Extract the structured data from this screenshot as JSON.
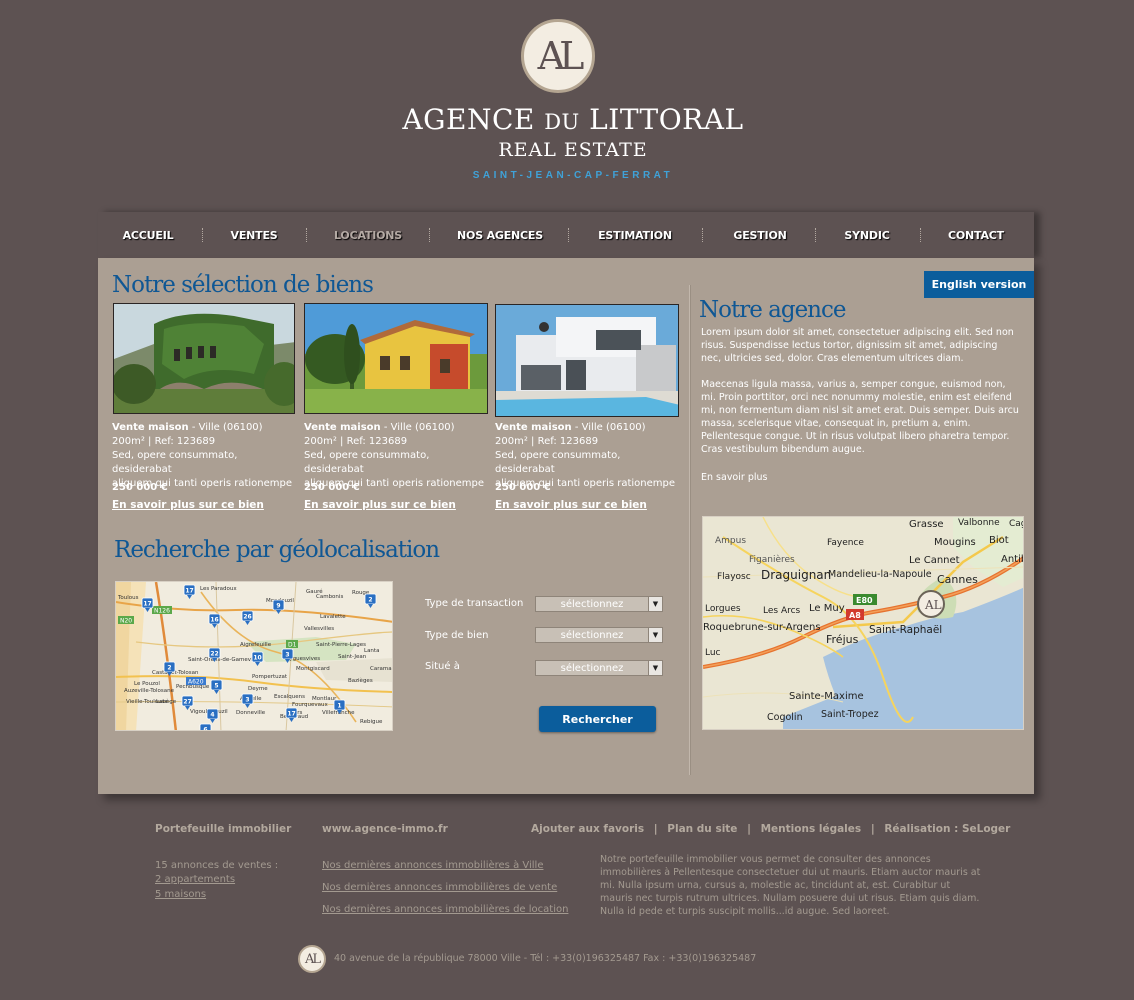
{
  "header": {
    "logo_monogram": "AL",
    "brand_agence": "AGENCE",
    "brand_du": "DU",
    "brand_littoral": "LITTORAL",
    "brand_subtitle": "REAL ESTATE",
    "brand_location": "SAINT-JEAN-CAP-FERRAT"
  },
  "nav": {
    "items": [
      "ACCUEIL",
      "VENTES",
      "LOCATIONS",
      "NOS AGENCES",
      "ESTIMATION",
      "GESTION",
      "SYNDIC",
      "CONTACT"
    ],
    "active": "LOCATIONS"
  },
  "english_button": "English version",
  "selection": {
    "title": "Notre sélection de biens",
    "cards": [
      {
        "type": "Vente maison",
        "city": "- Ville (06100)",
        "meta": "200m² | Ref: 123689",
        "desc1": "Sed, opere consummato, desiderabat",
        "desc2": "aliquem qui tanti operis rationempe",
        "price": "250 000 €",
        "link": "En savoir plus sur ce bien"
      },
      {
        "type": "Vente maison",
        "city": "- Ville (06100)",
        "meta": "200m² | Ref: 123689",
        "desc1": "Sed, opere consummato, desiderabat",
        "desc2": "aliquem qui tanti operis rationempe",
        "price": "250 000 €",
        "link": "En savoir plus sur ce bien"
      },
      {
        "type": "Vente maison",
        "city": "- Ville (06100)",
        "meta": "200m² | Ref: 123689",
        "desc1": "Sed, opere consummato, desiderabat",
        "desc2": "aliquem qui tanti operis rationempe",
        "price": "250 000 €",
        "link": "En savoir plus sur ce bien"
      }
    ]
  },
  "geo": {
    "title": "Recherche par géolocalisation",
    "map_labels": [
      "Les Paradoux",
      "Gauré",
      "Rouge",
      "Toulous",
      "Mondouzil",
      "Cambonis",
      "Lavalette",
      "Saint-Pierre-Lages",
      "Saint-Jean",
      "Bazièges",
      "Montgiscard",
      "Ayguesvives",
      "Montlaur",
      "Villefranche",
      "Odars",
      "Belberaud",
      "Auzielle",
      "Escalquens",
      "Castanet-Tolosan",
      "Labège",
      "Saint-Orens-de-Gameville",
      "Vallesvilles",
      "Aigrefeuille",
      "Lanta",
      "Caraman",
      "Le Pouzol",
      "Pechbusque",
      "Vieille-Toulouse",
      "Fourquevaux",
      "Vigoulet-Auzil",
      "Auzeville-Tolosane",
      "Rebigue",
      "Pompertuzat",
      "Donneville",
      "Deyme"
    ],
    "map_pins": [
      "17",
      "17",
      "16",
      "9",
      "2",
      "26",
      "22",
      "10",
      "3",
      "2",
      "5",
      "3",
      "27",
      "17",
      "4",
      "1",
      "6"
    ],
    "roads": [
      "N126",
      "N20",
      "D1",
      "A620"
    ],
    "form": {
      "transaction_label": "Type de transaction",
      "transaction_value": "sélectionnez",
      "bien_label": "Type de bien",
      "bien_value": "sélectionnez",
      "situe_label": "Situé à",
      "situe_value": "sélectionnez",
      "submit": "Rechercher"
    }
  },
  "agency": {
    "title": "Notre agence",
    "para1": "Lorem ipsum dolor sit amet, consectetuer adipiscing elit. Sed non risus. Suspendisse lectus tortor, dignissim sit amet, adipiscing nec, ultricies sed, dolor. Cras elementum ultrices diam.",
    "para2": "Maecenas ligula massa, varius a, semper congue, euismod non, mi. Proin porttitor, orci nec nonummy molestie, enim est eleifend mi, non fermentum diam nisl sit amet erat. Duis semper. Duis arcu massa, scelerisque vitae, consequat in, pretium a, enim. Pellentesque congue. Ut in risus volutpat libero pharetra tempor. Cras vestibulum bibendum augue.",
    "more": "En savoir plus",
    "map_labels": {
      "grasse": "Grasse",
      "valbonne": "Valbonne",
      "biot": "Biot",
      "antibes": "Antib",
      "cagnes": "Cag",
      "ampus": "Ampus",
      "figanieres": "Figanières",
      "fayence": "Fayence",
      "mougins": "Mougins",
      "flayosc": "Flayosc",
      "draguignan": "Draguignan",
      "mandelieu": "Mandelieu-la-Napoule",
      "lecannet": "Le Cannet",
      "cannes": "Cannes",
      "lorgues": "Lorgues",
      "lesarcs": "Les Arcs",
      "lemuy": "Le Muy",
      "e80": "E80",
      "a8": "A8",
      "roquebrune": "Roquebrune-sur-Argens",
      "frejus": "Fréjus",
      "straphael": "Saint-Raphaël",
      "luc": "Luc",
      "stemaxime": "Sainte-Maxime",
      "cogolin": "Cogolin",
      "sttropez": "Saint-Tropez"
    }
  },
  "footer": {
    "portfolio_head": "Portefeuille immobilier",
    "portfolio_count": "15 annonces de ventes :",
    "portfolio_link1": "2 appartements",
    "portfolio_link2": "5 maisons",
    "site_head": "www.agence-immo.fr",
    "site_link1": "Nos dernières annonces immobilières à Ville",
    "site_link2": "Nos dernières annonces immobilières de vente",
    "site_link3": "Nos dernières annonces immobilières de location",
    "top_link_favoris": "Ajouter aux favoris",
    "top_link_plan": "Plan du site",
    "top_link_mentions": "Mentions légales",
    "top_link_realisation": "Réalisation : SeLoger",
    "separator": "|",
    "description": "Notre portefeuille immobilier vous permet de consulter des annonces immobilières à Pellentesque consectetuer dui ut mauris. Etiam auctor mauris at mi. Nulla ipsum urna, cursus a, molestie ac, tincidunt at, est. Curabitur ut mauris nec turpis rutrum ultrices. Nullam posuere dui ut risus. Etiam quis diam. Nulla id pede et turpis suscipit mollis...id augue. Sed laoreet.",
    "logo_monogram": "AL",
    "address": "40 avenue de la république  78000 Ville  -  Tél : +33(0)196325487 Fax : +33(0)196325487"
  },
  "colors": {
    "background": "#5d5252",
    "panel": "#ab9f93",
    "accent_blue": "#0b5d9c",
    "title_blue": "#0f5794",
    "location_blue": "#3fa2d8"
  }
}
